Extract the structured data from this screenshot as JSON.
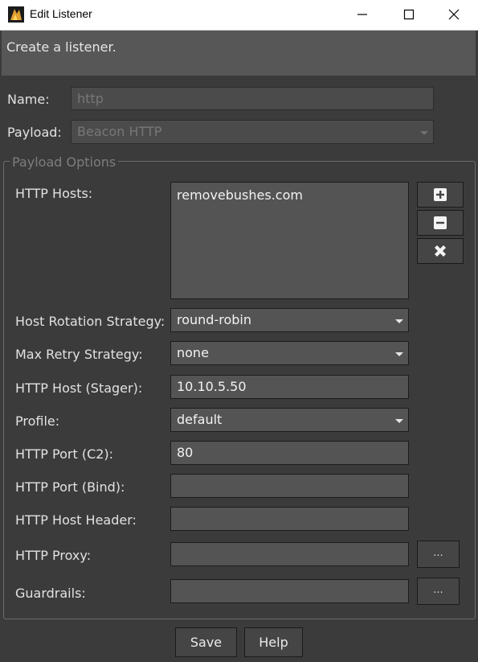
{
  "window": {
    "title": "Edit Listener"
  },
  "description": "Create a listener.",
  "name_field": {
    "label": "Name:",
    "value": "http"
  },
  "payload_field": {
    "label": "Payload:",
    "value": "Beacon HTTP"
  },
  "payload_options": {
    "title": "Payload Options",
    "http_hosts": {
      "label": "HTTP Hosts:",
      "items": [
        "removebushes.com"
      ]
    },
    "host_rotation": {
      "label": "Host Rotation Strategy:",
      "value": "round-robin"
    },
    "max_retry": {
      "label": "Max Retry Strategy:",
      "value": "none"
    },
    "http_host_stager": {
      "label": "HTTP Host (Stager):",
      "value": "10.10.5.50"
    },
    "profile": {
      "label": "Profile:",
      "value": "default"
    },
    "http_port_c2": {
      "label": "HTTP Port (C2):",
      "value": "80"
    },
    "http_port_bind": {
      "label": "HTTP Port (Bind):",
      "value": ""
    },
    "http_host_header": {
      "label": "HTTP Host Header:",
      "value": ""
    },
    "http_proxy": {
      "label": "HTTP Proxy:",
      "value": "",
      "button": "..."
    },
    "guardrails": {
      "label": "Guardrails:",
      "value": "",
      "button": "..."
    }
  },
  "buttons": {
    "save": "Save",
    "help": "Help"
  }
}
